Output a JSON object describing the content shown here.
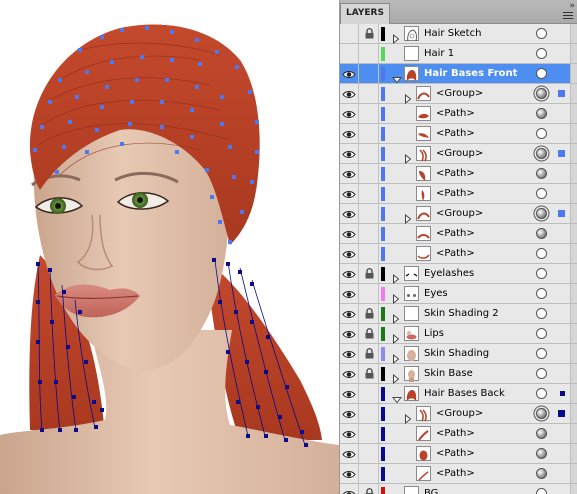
{
  "panel": {
    "tab_label": "LAYERS",
    "close_glyph": "»",
    "menu_icon": "panel-menu-icon"
  },
  "colors": {
    "selection_blue": "#4d8ef0",
    "hair_red": "#b8432a",
    "anchor_light_blue": "#4f78f0",
    "anchor_dark_blue": "#0a0a8a"
  },
  "layers": [
    {
      "name": "Hair Sketch",
      "visible": false,
      "locked": true,
      "color": "#000000",
      "indent": 0,
      "twirl": "closed",
      "thumb": "hair-sketch",
      "target": "empty",
      "selected": false,
      "sel_color": ""
    },
    {
      "name": "Hair 1",
      "visible": false,
      "locked": false,
      "color": "#5ad65a",
      "indent": 0,
      "twirl": "none",
      "thumb": "blank",
      "target": "empty",
      "selected": false,
      "sel_color": ""
    },
    {
      "name": "Hair Bases Front",
      "visible": true,
      "locked": false,
      "color": "#4f78f0",
      "indent": 0,
      "twirl": "open",
      "thumb": "hair-red",
      "target": "empty",
      "selected": true,
      "sel_color": ""
    },
    {
      "name": "<Group>",
      "visible": true,
      "locked": false,
      "color": "#4f78f0",
      "indent": 1,
      "twirl": "closed",
      "thumb": "group-stroke",
      "target": "double",
      "selected": false,
      "sel_color": "#4f78f0"
    },
    {
      "name": "<Path>",
      "visible": true,
      "locked": false,
      "color": "#4f78f0",
      "indent": 1,
      "twirl": "none",
      "thumb": "path-a",
      "target": "filled",
      "selected": false,
      "sel_color": ""
    },
    {
      "name": "<Path>",
      "visible": true,
      "locked": false,
      "color": "#4f78f0",
      "indent": 1,
      "twirl": "none",
      "thumb": "path-b",
      "target": "empty",
      "selected": false,
      "sel_color": ""
    },
    {
      "name": "<Group>",
      "visible": true,
      "locked": false,
      "color": "#4f78f0",
      "indent": 1,
      "twirl": "closed",
      "thumb": "group-hair",
      "target": "double",
      "selected": false,
      "sel_color": "#4f78f0"
    },
    {
      "name": "<Path>",
      "visible": true,
      "locked": false,
      "color": "#4f78f0",
      "indent": 1,
      "twirl": "none",
      "thumb": "path-c",
      "target": "filled",
      "selected": false,
      "sel_color": ""
    },
    {
      "name": "<Path>",
      "visible": true,
      "locked": false,
      "color": "#4f78f0",
      "indent": 1,
      "twirl": "none",
      "thumb": "path-d",
      "target": "empty",
      "selected": false,
      "sel_color": ""
    },
    {
      "name": "<Group>",
      "visible": true,
      "locked": false,
      "color": "#4f78f0",
      "indent": 1,
      "twirl": "closed",
      "thumb": "group-stroke",
      "target": "double",
      "selected": false,
      "sel_color": "#4f78f0"
    },
    {
      "name": "<Path>",
      "visible": true,
      "locked": false,
      "color": "#4f78f0",
      "indent": 1,
      "twirl": "none",
      "thumb": "path-e",
      "target": "filled",
      "selected": false,
      "sel_color": ""
    },
    {
      "name": "<Path>",
      "visible": true,
      "locked": false,
      "color": "#4f78f0",
      "indent": 1,
      "twirl": "none",
      "thumb": "path-f",
      "target": "empty",
      "selected": false,
      "sel_color": ""
    },
    {
      "name": "Eyelashes",
      "visible": true,
      "locked": true,
      "color": "#000000",
      "indent": 0,
      "twirl": "closed",
      "thumb": "eyelashes",
      "target": "empty",
      "selected": false,
      "sel_color": ""
    },
    {
      "name": "Eyes",
      "visible": true,
      "locked": false,
      "color": "#f07af0",
      "indent": 0,
      "twirl": "closed",
      "thumb": "eyes",
      "target": "empty",
      "selected": false,
      "sel_color": ""
    },
    {
      "name": "Skin Shading 2",
      "visible": true,
      "locked": true,
      "color": "#1a7a1a",
      "indent": 0,
      "twirl": "closed",
      "thumb": "blank",
      "target": "empty",
      "selected": false,
      "sel_color": ""
    },
    {
      "name": "Lips",
      "visible": true,
      "locked": true,
      "color": "#1a7a1a",
      "indent": 0,
      "twirl": "closed",
      "thumb": "lips",
      "target": "empty",
      "selected": false,
      "sel_color": ""
    },
    {
      "name": "Skin Shading",
      "visible": true,
      "locked": true,
      "color": "#8a8af0",
      "indent": 0,
      "twirl": "closed",
      "thumb": "skin",
      "target": "empty",
      "selected": false,
      "sel_color": ""
    },
    {
      "name": "Skin Base",
      "visible": true,
      "locked": true,
      "color": "#000000",
      "indent": 0,
      "twirl": "closed",
      "thumb": "skin-base",
      "target": "empty",
      "selected": false,
      "sel_color": ""
    },
    {
      "name": "Hair Bases Back",
      "visible": true,
      "locked": false,
      "color": "#0a0a8a",
      "indent": 0,
      "twirl": "open",
      "thumb": "hair-back",
      "target": "empty",
      "selected": false,
      "sel_color": "#0a0a8a"
    },
    {
      "name": "<Group>",
      "visible": true,
      "locked": false,
      "color": "#0a0a8a",
      "indent": 1,
      "twirl": "closed",
      "thumb": "group-hair",
      "target": "double",
      "selected": false,
      "sel_color": "#0a0a8a"
    },
    {
      "name": "<Path>",
      "visible": true,
      "locked": false,
      "color": "#0a0a8a",
      "indent": 1,
      "twirl": "none",
      "thumb": "path-g",
      "target": "filled",
      "selected": false,
      "sel_color": ""
    },
    {
      "name": "<Path>",
      "visible": true,
      "locked": false,
      "color": "#0a0a8a",
      "indent": 1,
      "twirl": "none",
      "thumb": "path-h",
      "target": "filled",
      "selected": false,
      "sel_color": ""
    },
    {
      "name": "<Path>",
      "visible": true,
      "locked": false,
      "color": "#0a0a8a",
      "indent": 1,
      "twirl": "none",
      "thumb": "path-i",
      "target": "filled",
      "selected": false,
      "sel_color": ""
    },
    {
      "name": "BG",
      "visible": true,
      "locked": true,
      "color": "#d01010",
      "indent": 0,
      "twirl": "closed",
      "thumb": "blank",
      "target": "empty",
      "selected": false,
      "sel_color": ""
    }
  ]
}
